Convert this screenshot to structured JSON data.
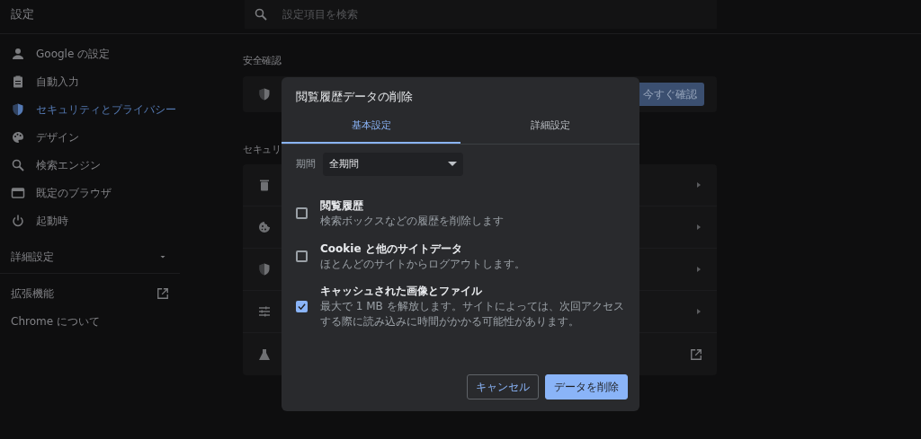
{
  "header": {
    "title": "設定",
    "search": {
      "placeholder": "設定項目を検索"
    }
  },
  "sidebar": {
    "items": [
      {
        "label": "Google の設定",
        "selected": false
      },
      {
        "label": "自動入力",
        "selected": false
      },
      {
        "label": "セキュリティとプライバシー",
        "selected": true
      },
      {
        "label": "デザイン",
        "selected": false
      },
      {
        "label": "検索エンジン",
        "selected": false
      },
      {
        "label": "既定のブラウザ",
        "selected": false
      },
      {
        "label": "起動時",
        "selected": false
      }
    ],
    "advanced": {
      "label": "詳細設定",
      "expanded": false
    },
    "links": [
      {
        "label": "拡張機能",
        "external": true
      },
      {
        "label": "Chrome について",
        "external": false
      }
    ]
  },
  "main": {
    "safety_check": {
      "heading": "安全確認",
      "button": "今すぐ確認"
    },
    "security": {
      "heading": "セキュリ",
      "rows": [
        {
          "kind": "arrow"
        },
        {
          "kind": "arrow"
        },
        {
          "kind": "arrow"
        },
        {
          "kind": "arrow"
        },
        {
          "kind": "external"
        }
      ]
    }
  },
  "dialog": {
    "title": "閲覧履歴データの削除",
    "tabs": [
      {
        "label": "基本設定",
        "selected": true
      },
      {
        "label": "詳細設定",
        "selected": false
      }
    ],
    "period": {
      "label": "期間",
      "value": "全期間"
    },
    "options": [
      {
        "title": "閲覧履歴",
        "description": "検索ボックスなどの履歴を削除します",
        "checked": false
      },
      {
        "title": "Cookie と他のサイトデータ",
        "description": "ほとんどのサイトからログアウトします。",
        "checked": false
      },
      {
        "title": "キャッシュされた画像とファイル",
        "description": "最大で 1 MB を解放します。サイトによっては、次回アクセスする際に読み込みに時間がかかる可能性があります。",
        "checked": true
      }
    ],
    "buttons": [
      {
        "label": "キャンセル",
        "kind": "secondary"
      },
      {
        "label": "データを削除",
        "kind": "primary"
      }
    ]
  }
}
